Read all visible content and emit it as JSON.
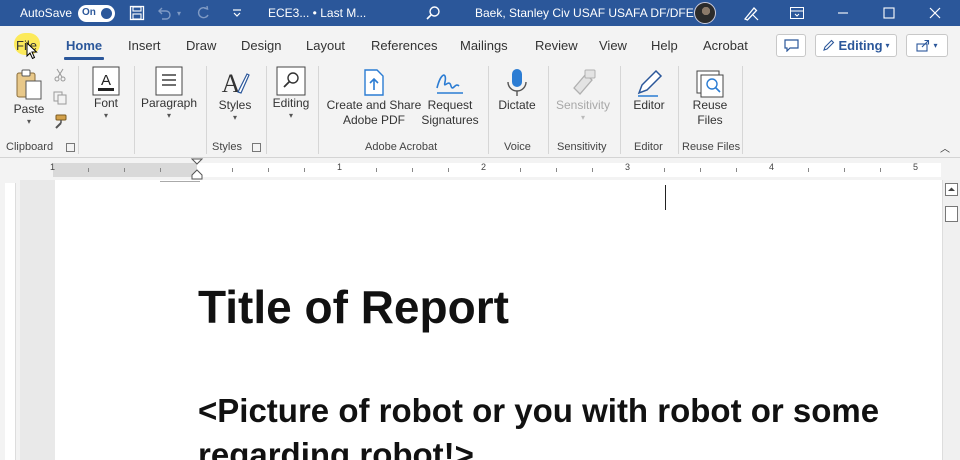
{
  "titlebar": {
    "autosave_label": "AutoSave",
    "autosave_state": "On",
    "document": "ECE3...  •  Last M...",
    "user": "Baek, Stanley Civ USAF USAFA DF/DFEC",
    "bg": "#2b579a"
  },
  "tabs": [
    {
      "label": "File"
    },
    {
      "label": "Home"
    },
    {
      "label": "Insert"
    },
    {
      "label": "Draw"
    },
    {
      "label": "Design"
    },
    {
      "label": "Layout"
    },
    {
      "label": "References"
    },
    {
      "label": "Mailings"
    },
    {
      "label": "Review"
    },
    {
      "label": "View"
    },
    {
      "label": "Help"
    },
    {
      "label": "Acrobat"
    }
  ],
  "editing_mode": "Editing",
  "ribbon": {
    "paste": "Paste",
    "font": "Font",
    "paragraph": "Paragraph",
    "styles": "Styles",
    "editing": "Editing",
    "create_share_1": "Create and Share",
    "create_share_2": "Adobe PDF",
    "request_1": "Request",
    "request_2": "Signatures",
    "dictate": "Dictate",
    "sensitivity": "Sensitivity",
    "editor": "Editor",
    "reuse_1": "Reuse",
    "reuse_2": "Files",
    "groups": {
      "clipboard": "Clipboard",
      "styles": "Styles",
      "adobe": "Adobe Acrobat",
      "voice": "Voice",
      "sensitivity": "Sensitivity",
      "editor": "Editor",
      "reuse": "Reuse Files"
    }
  },
  "ruler": {
    "numbers": [
      "1",
      "1",
      "2",
      "3",
      "4",
      "5"
    ]
  },
  "document": {
    "title": "Title of Report",
    "line1": "<Picture of robot or you with robot or some",
    "line2": "regarding robot!>"
  },
  "colors": {
    "accent": "#2b579a",
    "highlight": "#fde94a"
  }
}
